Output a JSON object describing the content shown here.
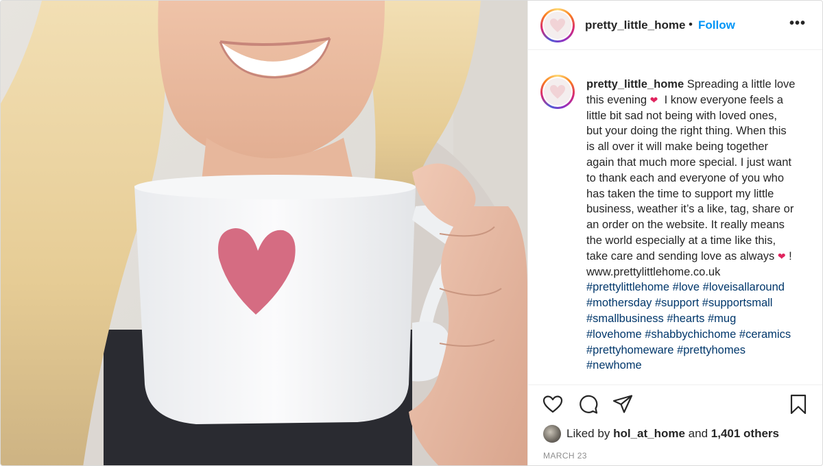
{
  "post": {
    "username": "pretty_little_home",
    "separator": "•",
    "follow_label": "Follow",
    "more_label": "•••",
    "caption": {
      "username": "pretty_little_home",
      "lines": [
        "Spreading a little love",
        "this evening",
        "I know everyone feels a",
        "little bit sad not being with loved ones,",
        "but your doing the right thing. When this",
        "is all over it will make being together",
        "again that much more special. I just want",
        "to thank each and everyone of you who",
        "has taken the time to support my little",
        "business, weather it’s a like, tag, share or",
        "an order on the website. It really means",
        "the world especially at a time like this,",
        "take care and sending love as always",
        "!",
        "www.prettylittlehome.co.uk"
      ],
      "heart_emoji": "❤",
      "hashtag_lines": [
        "#prettylittlehome #love #loveisallaround",
        "#mothersday #support #supportsmall",
        "#smallbusiness #hearts #mug",
        "#lovehome #shabbychichome #ceramics",
        "#prettyhomeware #prettyhomes",
        "#newhome"
      ]
    },
    "likes": {
      "prefix": "Liked by",
      "liker": "hol_at_home",
      "joiner": "and",
      "others": "1,401 others"
    },
    "date": "MARCH 23",
    "icons": {
      "like": "heart-outline-icon",
      "comment": "comment-bubble-icon",
      "share": "paper-plane-icon",
      "save": "bookmark-icon",
      "more": "more-options-icon"
    },
    "colors": {
      "link_blue": "#0095f6",
      "hashtag": "#00376b",
      "text": "#262626",
      "muted": "#8e8e8e",
      "heart_red": "#e0245e"
    }
  }
}
